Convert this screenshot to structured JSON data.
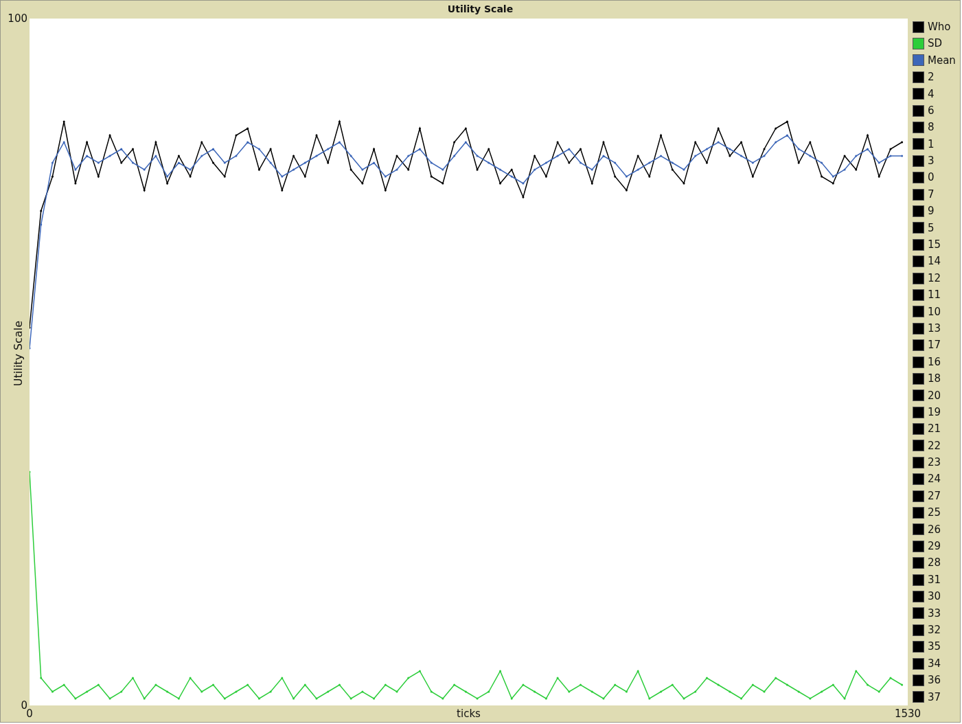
{
  "chart_data": {
    "type": "line",
    "title": "Utility Scale",
    "legend": "right",
    "xlabel": "ticks",
    "ylabel": "Utility Scale",
    "xlim": [
      0,
      1530
    ],
    "ylim": [
      0,
      100
    ],
    "xticks": [
      {
        "value": 0,
        "label": "0"
      },
      {
        "value": 1530,
        "label": "1530"
      }
    ],
    "yticks": [
      {
        "value": 0,
        "label": "0"
      },
      {
        "value": 100,
        "label": "100"
      }
    ],
    "x": [
      0,
      20,
      40,
      60,
      80,
      100,
      120,
      140,
      160,
      180,
      200,
      220,
      240,
      260,
      280,
      300,
      320,
      340,
      360,
      380,
      400,
      420,
      440,
      460,
      480,
      500,
      520,
      540,
      560,
      580,
      600,
      620,
      640,
      660,
      680,
      700,
      720,
      740,
      760,
      780,
      800,
      820,
      840,
      860,
      880,
      900,
      920,
      940,
      960,
      980,
      1000,
      1020,
      1040,
      1060,
      1080,
      1100,
      1120,
      1140,
      1160,
      1180,
      1200,
      1220,
      1240,
      1260,
      1280,
      1300,
      1320,
      1340,
      1360,
      1380,
      1400,
      1420,
      1440,
      1460,
      1480,
      1500,
      1520
    ],
    "series": [
      {
        "name": "Who",
        "color": "#000000",
        "values": [
          55,
          72,
          77,
          85,
          76,
          82,
          77,
          83,
          79,
          81,
          75,
          82,
          76,
          80,
          77,
          82,
          79,
          77,
          83,
          84,
          78,
          81,
          75,
          80,
          77,
          83,
          79,
          85,
          78,
          76,
          81,
          75,
          80,
          78,
          84,
          77,
          76,
          82,
          84,
          78,
          81,
          76,
          78,
          74,
          80,
          77,
          82,
          79,
          81,
          76,
          82,
          77,
          75,
          80,
          77,
          83,
          78,
          76,
          82,
          79,
          84,
          80,
          82,
          77,
          81,
          84,
          85,
          79,
          82,
          77,
          76,
          80,
          78,
          83,
          77,
          81,
          82
        ]
      },
      {
        "name": "SD",
        "color": "#2ccd3a",
        "values": [
          34,
          4,
          2,
          3,
          1,
          2,
          3,
          1,
          2,
          4,
          1,
          3,
          2,
          1,
          4,
          2,
          3,
          1,
          2,
          3,
          1,
          2,
          4,
          1,
          3,
          1,
          2,
          3,
          1,
          2,
          1,
          3,
          2,
          4,
          5,
          2,
          1,
          3,
          2,
          1,
          2,
          5,
          1,
          3,
          2,
          1,
          4,
          2,
          3,
          2,
          1,
          3,
          2,
          5,
          1,
          2,
          3,
          1,
          2,
          4,
          3,
          2,
          1,
          3,
          2,
          4,
          3,
          2,
          1,
          2,
          3,
          1,
          5,
          3,
          2,
          4,
          3
        ]
      },
      {
        "name": "Mean",
        "color": "#3c66b8",
        "values": [
          52,
          70,
          79,
          82,
          78,
          80,
          79,
          80,
          81,
          79,
          78,
          80,
          77,
          79,
          78,
          80,
          81,
          79,
          80,
          82,
          81,
          79,
          77,
          78,
          79,
          80,
          81,
          82,
          80,
          78,
          79,
          77,
          78,
          80,
          81,
          79,
          78,
          80,
          82,
          80,
          79,
          78,
          77,
          76,
          78,
          79,
          80,
          81,
          79,
          78,
          80,
          79,
          77,
          78,
          79,
          80,
          79,
          78,
          80,
          81,
          82,
          81,
          80,
          79,
          80,
          82,
          83,
          81,
          80,
          79,
          77,
          78,
          80,
          81,
          79,
          80,
          80
        ]
      }
    ]
  },
  "legend": [
    {
      "label": "2",
      "color": "#000000"
    },
    {
      "label": "4",
      "color": "#000000"
    },
    {
      "label": "6",
      "color": "#000000"
    },
    {
      "label": "8",
      "color": "#000000"
    },
    {
      "label": "1",
      "color": "#000000"
    },
    {
      "label": "3",
      "color": "#000000"
    },
    {
      "label": "0",
      "color": "#000000"
    },
    {
      "label": "7",
      "color": "#000000"
    },
    {
      "label": "9",
      "color": "#000000"
    },
    {
      "label": "5",
      "color": "#000000"
    },
    {
      "label": "15",
      "color": "#000000"
    },
    {
      "label": "14",
      "color": "#000000"
    },
    {
      "label": "12",
      "color": "#000000"
    },
    {
      "label": "11",
      "color": "#000000"
    },
    {
      "label": "10",
      "color": "#000000"
    },
    {
      "label": "13",
      "color": "#000000"
    },
    {
      "label": "17",
      "color": "#000000"
    },
    {
      "label": "16",
      "color": "#000000"
    },
    {
      "label": "18",
      "color": "#000000"
    },
    {
      "label": "20",
      "color": "#000000"
    },
    {
      "label": "19",
      "color": "#000000"
    },
    {
      "label": "21",
      "color": "#000000"
    },
    {
      "label": "22",
      "color": "#000000"
    },
    {
      "label": "23",
      "color": "#000000"
    },
    {
      "label": "24",
      "color": "#000000"
    },
    {
      "label": "27",
      "color": "#000000"
    },
    {
      "label": "25",
      "color": "#000000"
    },
    {
      "label": "26",
      "color": "#000000"
    },
    {
      "label": "29",
      "color": "#000000"
    },
    {
      "label": "28",
      "color": "#000000"
    },
    {
      "label": "31",
      "color": "#000000"
    },
    {
      "label": "30",
      "color": "#000000"
    },
    {
      "label": "33",
      "color": "#000000"
    },
    {
      "label": "32",
      "color": "#000000"
    },
    {
      "label": "35",
      "color": "#000000"
    },
    {
      "label": "34",
      "color": "#000000"
    },
    {
      "label": "36",
      "color": "#000000"
    },
    {
      "label": "37",
      "color": "#000000"
    }
  ]
}
